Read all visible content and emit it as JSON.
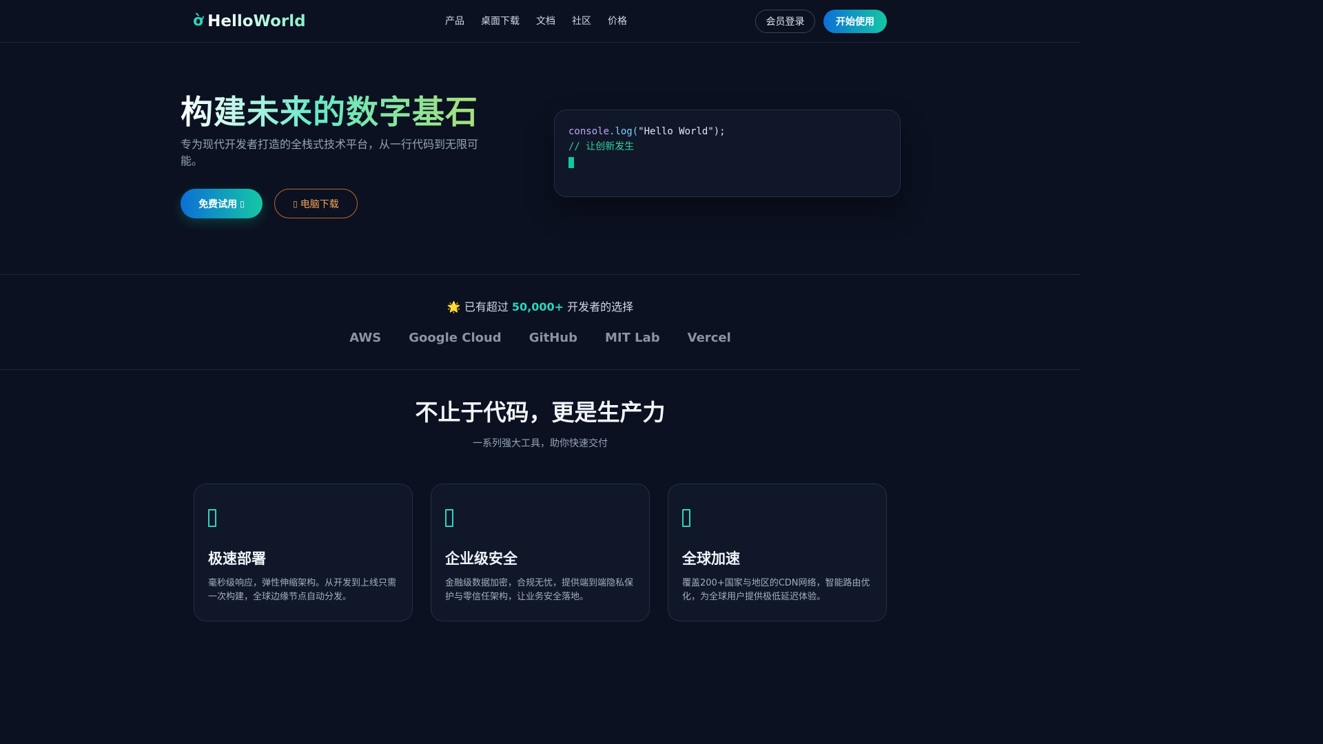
{
  "nav": {
    "logo_mark": "ờ",
    "logo_text": "HelloWorld",
    "links": [
      "产品",
      "桌面下载",
      "文档",
      "社区",
      "价格"
    ],
    "login_label": "会员登录",
    "start_label": "开始使用"
  },
  "hero": {
    "title": "构建未来的数字基石",
    "subtitle": "专为现代开发者打造的全栈式技术平台，从一行代码到无限可能。",
    "trial_label": "免费试用",
    "download_label": "电脑下载",
    "code": {
      "fn": "console",
      "dot": ".log(",
      "str": "\"Hello World\");",
      "comment": "// 让创新发生"
    }
  },
  "social": {
    "emoji": "🌟",
    "prefix": "已有超过",
    "count": "50,000+",
    "suffix": "开发者的选择",
    "brands": [
      "AWS",
      "Google Cloud",
      "GitHub",
      "MIT Lab",
      "Vercel"
    ]
  },
  "features": {
    "title": "不止于代码，更是生产力",
    "subtitle": "一系列强大工具，助你快速交付",
    "cards": [
      {
        "title": "极速部署",
        "desc": "毫秒级响应，弹性伸缩架构。从开发到上线只需一次构建，全球边缘节点自动分发。"
      },
      {
        "title": "企业级安全",
        "desc": "金融级数据加密，合规无忧，提供端到端隐私保护与零信任架构，让业务安全落地。"
      },
      {
        "title": "全球加速",
        "desc": "覆盖200+国家与地区的CDN网络，智能路由优化，为全球用户提供极低延迟体验。"
      }
    ]
  },
  "colors": {
    "background": "#0b1120",
    "accent": "#2dd4bf",
    "button_gradient_start": "#0c6fd6",
    "button_gradient_end": "#15c7a4",
    "download_accent": "#f5a35a"
  }
}
